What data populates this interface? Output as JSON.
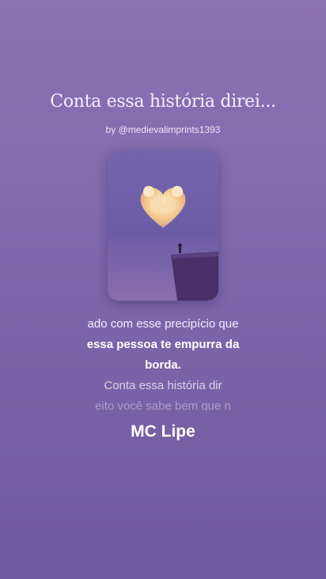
{
  "song": {
    "title": "Conta essa história direi...",
    "byline": "by @medievalimprints1393",
    "artist": "MC Lipe"
  },
  "cover": {
    "icon": "heart-cloud-cliff-artwork",
    "colors": {
      "sky": "#6f5fa8",
      "heart": "#f6d7a8",
      "cliff": "#4a2f68"
    }
  },
  "lyrics": {
    "line_past": "ado com esse precipício que",
    "line_active_1": "essa pessoa te empurra da",
    "line_active_2": "borda.",
    "line_next": "Conta essa história dir",
    "line_fade": "eito você sabe bem que n"
  }
}
